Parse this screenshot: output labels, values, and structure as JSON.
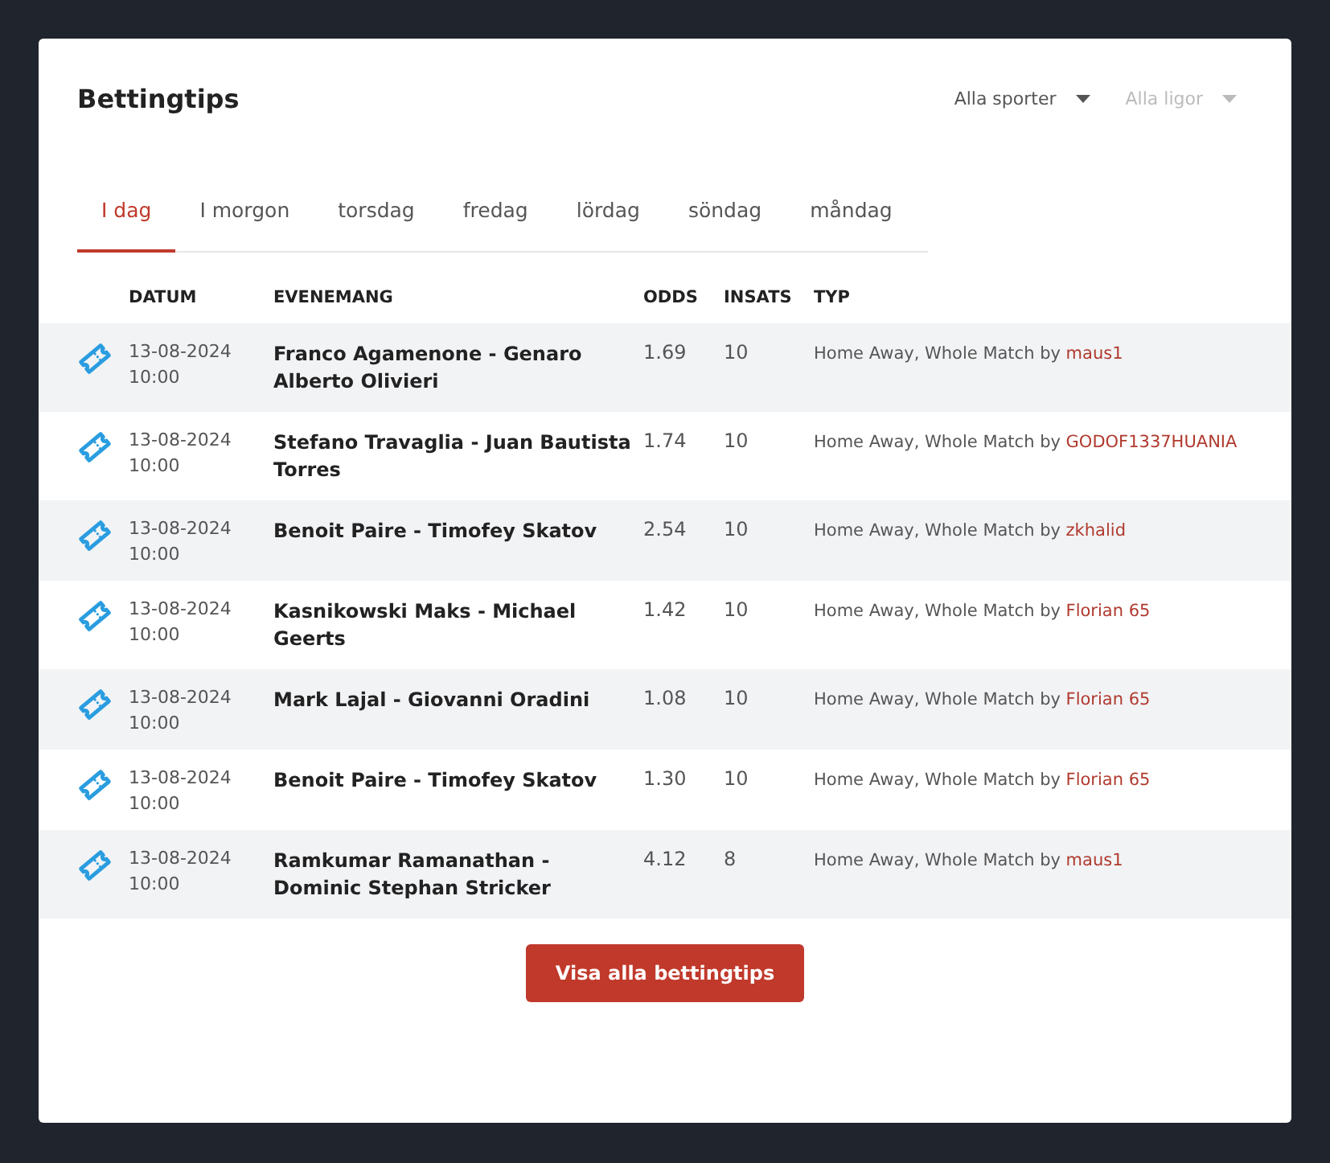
{
  "title": "Bettingtips",
  "filters": [
    {
      "label": "Alla sporter",
      "disabled": false
    },
    {
      "label": "Alla ligor",
      "disabled": true
    }
  ],
  "tabs": [
    {
      "label": "I dag",
      "selected": true
    },
    {
      "label": "I morgon",
      "selected": false
    },
    {
      "label": "torsdag",
      "selected": false
    },
    {
      "label": "fredag",
      "selected": false
    },
    {
      "label": "lördag",
      "selected": false
    },
    {
      "label": "söndag",
      "selected": false
    },
    {
      "label": "måndag",
      "selected": false
    }
  ],
  "table": {
    "columns": [
      "DATUM",
      "EVENEMANG",
      "ODDS",
      "INSATS",
      "TYP"
    ],
    "rows": [
      {
        "date": "13-08-2024",
        "time": "10:00",
        "event": "Franco Agamenone - Genaro Alberto Olivieri",
        "odds": "1.69",
        "stake": "10",
        "type": "Home Away, Whole Match by",
        "author": "maus1"
      },
      {
        "date": "13-08-2024",
        "time": "10:00",
        "event": "Stefano Travaglia - Juan Bautista Torres",
        "odds": "1.74",
        "stake": "10",
        "type": "Home Away, Whole Match by",
        "author": "GODOF1337HUANIA"
      },
      {
        "date": "13-08-2024",
        "time": "10:00",
        "event": "Benoit Paire - Timofey Skatov",
        "odds": "2.54",
        "stake": "10",
        "type": "Home Away, Whole Match by",
        "author": "zkhalid"
      },
      {
        "date": "13-08-2024",
        "time": "10:00",
        "event": "Kasnikowski Maks - Michael Geerts",
        "odds": "1.42",
        "stake": "10",
        "type": "Home Away, Whole Match by",
        "author": "Florian 65"
      },
      {
        "date": "13-08-2024",
        "time": "10:00",
        "event": "Mark Lajal - Giovanni Oradini",
        "odds": "1.08",
        "stake": "10",
        "type": "Home Away, Whole Match by",
        "author": "Florian 65"
      },
      {
        "date": "13-08-2024",
        "time": "10:00",
        "event": "Benoit Paire - Timofey Skatov",
        "odds": "1.30",
        "stake": "10",
        "type": "Home Away, Whole Match by",
        "author": "Florian 65"
      },
      {
        "date": "13-08-2024",
        "time": "10:00",
        "event": "Ramkumar Ramanathan - Dominic Stephan Stricker",
        "odds": "4.12",
        "stake": "8",
        "type": "Home Away, Whole Match by",
        "author": "maus1"
      }
    ]
  },
  "button": "Visa alla bettingtips"
}
